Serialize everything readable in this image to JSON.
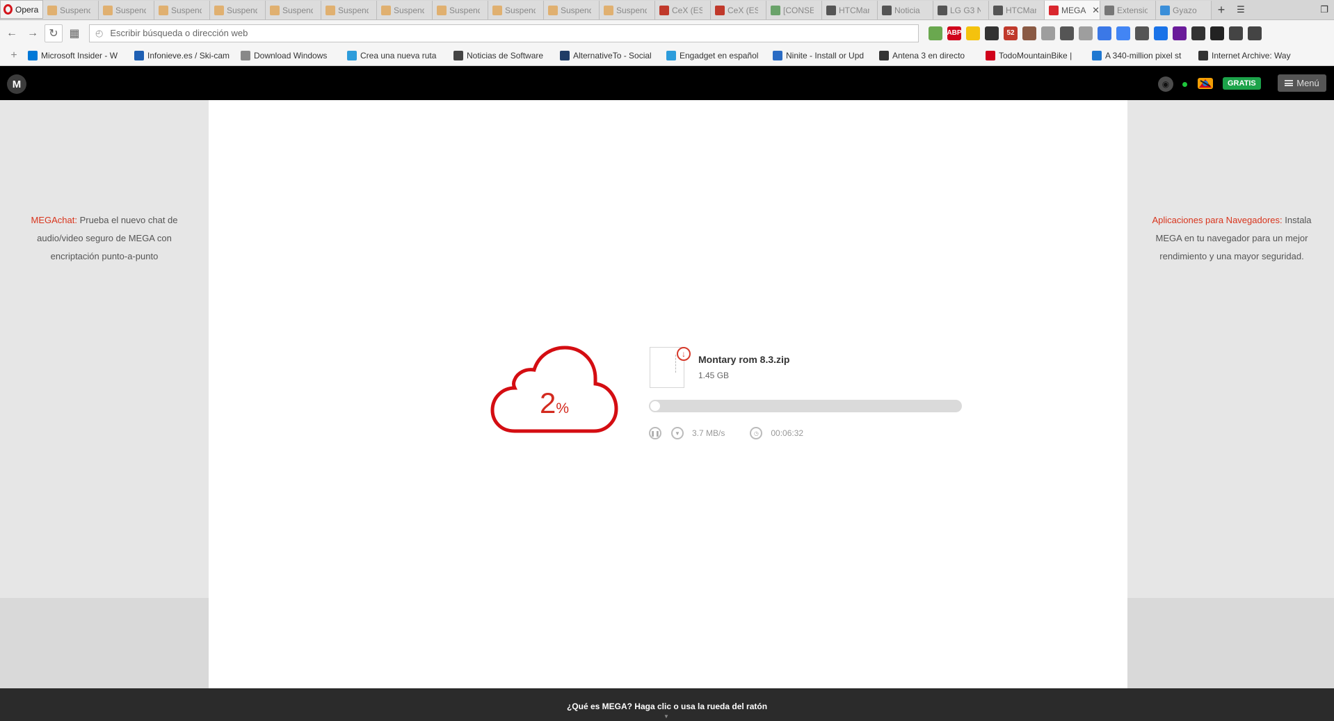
{
  "browser": {
    "opera_label": "Opera",
    "tabs": [
      {
        "label": "Suspended",
        "fav": "#e0b070"
      },
      {
        "label": "Suspended",
        "fav": "#e0b070"
      },
      {
        "label": "Suspended",
        "fav": "#e0b070"
      },
      {
        "label": "Suspended",
        "fav": "#e0b070"
      },
      {
        "label": "Suspended",
        "fav": "#e0b070"
      },
      {
        "label": "Suspended",
        "fav": "#e0b070"
      },
      {
        "label": "Suspended",
        "fav": "#e0b070"
      },
      {
        "label": "Suspended",
        "fav": "#e0b070"
      },
      {
        "label": "Suspended",
        "fav": "#e0b070"
      },
      {
        "label": "Suspended",
        "fav": "#e0b070"
      },
      {
        "label": "Suspended",
        "fav": "#e0b070"
      },
      {
        "label": "CeX (ES)",
        "fav": "#c0392b"
      },
      {
        "label": "CeX (ES)",
        "fav": "#c0392b"
      },
      {
        "label": "[CONSEJO]",
        "fav": "#6aa36a"
      },
      {
        "label": "HTCMania",
        "fav": "#555555"
      },
      {
        "label": "Noticia",
        "fav": "#555555"
      },
      {
        "label": "LG G3 N",
        "fav": "#555555"
      },
      {
        "label": "HTCMania",
        "fav": "#555555"
      },
      {
        "label": "MEGA",
        "fav": "#d9272e"
      },
      {
        "label": "Extensiones",
        "fav": "#777777"
      },
      {
        "label": "Gyazo",
        "fav": "#3b8fd9"
      }
    ],
    "active_tab_index": 18,
    "new_tab_symbol": "+",
    "address_placeholder": "Escribir búsqueda o dirección web",
    "bookmarks": [
      {
        "label": "Microsoft Insider - W",
        "color": "#0078d7"
      },
      {
        "label": "Infonieve.es / Ski-cam",
        "color": "#1e5fb3"
      },
      {
        "label": "Download Windows",
        "color": "#888888"
      },
      {
        "label": "Crea una nueva ruta",
        "color": "#2d9cdb"
      },
      {
        "label": "Noticias de Software",
        "color": "#444444"
      },
      {
        "label": "AlternativeTo - Social",
        "color": "#1f3c66"
      },
      {
        "label": "Engadget en español",
        "color": "#2d9cdb"
      },
      {
        "label": "Ninite - Install or Upd",
        "color": "#2b6cc4"
      },
      {
        "label": "Antena 3 en directo",
        "color": "#333333"
      },
      {
        "label": "TodoMountainBike |",
        "color": "#d0021b"
      },
      {
        "label": "A 340-million pixel st",
        "color": "#1f78d1"
      },
      {
        "label": "Internet Archive: Way",
        "color": "#333333"
      }
    ],
    "extensions": [
      {
        "name": "refresh-ext-icon",
        "color": "#6aa84f"
      },
      {
        "name": "adblock-icon",
        "color": "#d0021b",
        "text": "ABP"
      },
      {
        "name": "notes-ext-icon",
        "color": "#f4c20d"
      },
      {
        "name": "bookmark-ext-icon",
        "color": "#333333"
      },
      {
        "name": "calendar-ext-icon",
        "color": "#c0392b",
        "text": "52"
      },
      {
        "name": "instagram-ext-icon",
        "color": "#8a5a44"
      },
      {
        "name": "tab-ext-icon",
        "color": "#9e9e9e"
      },
      {
        "name": "save-ext-icon",
        "color": "#555555"
      },
      {
        "name": "zoom-ext-icon",
        "color": "#9e9e9e"
      },
      {
        "name": "translate-ext-icon",
        "color": "#3b78e7"
      },
      {
        "name": "google-translate-icon",
        "color": "#4285f4"
      },
      {
        "name": "ghost-ext-icon",
        "color": "#555555"
      },
      {
        "name": "network-ext-icon",
        "color": "#1a73e8"
      },
      {
        "name": "music-ext-icon",
        "color": "#6a1b9a"
      },
      {
        "name": "edge-ext-icon",
        "color": "#333333"
      },
      {
        "name": "amazon-ext-icon",
        "color": "#222222"
      },
      {
        "name": "download-ext-icon",
        "color": "#444444"
      },
      {
        "name": "wrench-ext-icon",
        "color": "#444444"
      }
    ]
  },
  "mega": {
    "logo_letter": "M",
    "plan_badge": "GRATIS",
    "menu_label": "Menú",
    "left_promo": {
      "highlight": "MEGAchat:",
      "text": " Prueba el nuevo chat de audio/video seguro de MEGA con encriptación punto-a-punto"
    },
    "right_promo": {
      "highlight": "Aplicaciones para Navegadores:",
      "text": " Instala MEGA en tu navegador para un mejor rendimiento y una mayor seguridad."
    },
    "download": {
      "percent": "2",
      "percent_symbol": "%",
      "file_name": "Montary rom 8.3.zip",
      "file_size": "1.45 GB",
      "progress_fraction": 0.02,
      "speed": "3.7 MB/s",
      "time_remaining": "00:06:32"
    },
    "footer": "¿Qué es MEGA? Haga clic o usa la rueda del ratón",
    "colors": {
      "accent": "#d9272e",
      "cloud": "#d40d12",
      "plan": "#1ca34a"
    }
  }
}
